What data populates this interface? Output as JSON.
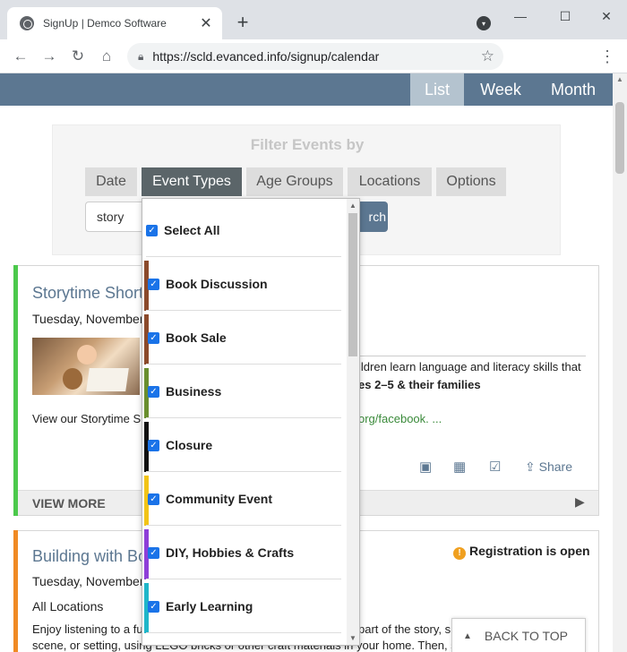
{
  "browser": {
    "tab_title": "SignUp | Demco Software",
    "url": "https://scld.evanced.info/signup/calendar"
  },
  "viewbar": {
    "list": "List",
    "week": "Week",
    "month": "Month"
  },
  "filter": {
    "title": "Filter Events by",
    "tabs": [
      "Date",
      "Event Types",
      "Age Groups",
      "Locations",
      "Options"
    ],
    "search_value": "story",
    "search_button": "rch"
  },
  "dropdown": {
    "select_all": "Select All",
    "items": [
      {
        "label": "Book Discussion",
        "color": "#8b4a2b"
      },
      {
        "label": "Book Sale",
        "color": "#8b4a2b"
      },
      {
        "label": "Business",
        "color": "#6a8f2f"
      },
      {
        "label": "Closure",
        "color": "#111111"
      },
      {
        "label": "Community Event",
        "color": "#f2c418"
      },
      {
        "label": "DIY, Hobbies & Crafts",
        "color": "#8e3fd8"
      },
      {
        "label": "Early Learning",
        "color": "#1fb6c9"
      }
    ]
  },
  "event1": {
    "title": "Storytime Short",
    "date": "Tuesday, November (",
    "desc_right": "ildren learn language and literacy skills that",
    "ages": "es 2–5 & their families",
    "view_text": "View our Storytime Sl",
    "link_text": "org/facebook. ...",
    "share": "Share",
    "view_more": "VIEW MORE",
    "bar_color": "#4cc94c"
  },
  "event2": {
    "title": "Building with Bo",
    "date": "Tuesday, November (",
    "location": "All Locations",
    "registration": "Registration is open",
    "line1_left": "Enjoy listening to a fu",
    "line1_right": "part of the story, s",
    "line2": "scene, or setting, using LEGO bricks or other craft materials in your home. Then, s",
    "bar_color": "#f08a24"
  },
  "back_to_top": "BACK TO TOP"
}
